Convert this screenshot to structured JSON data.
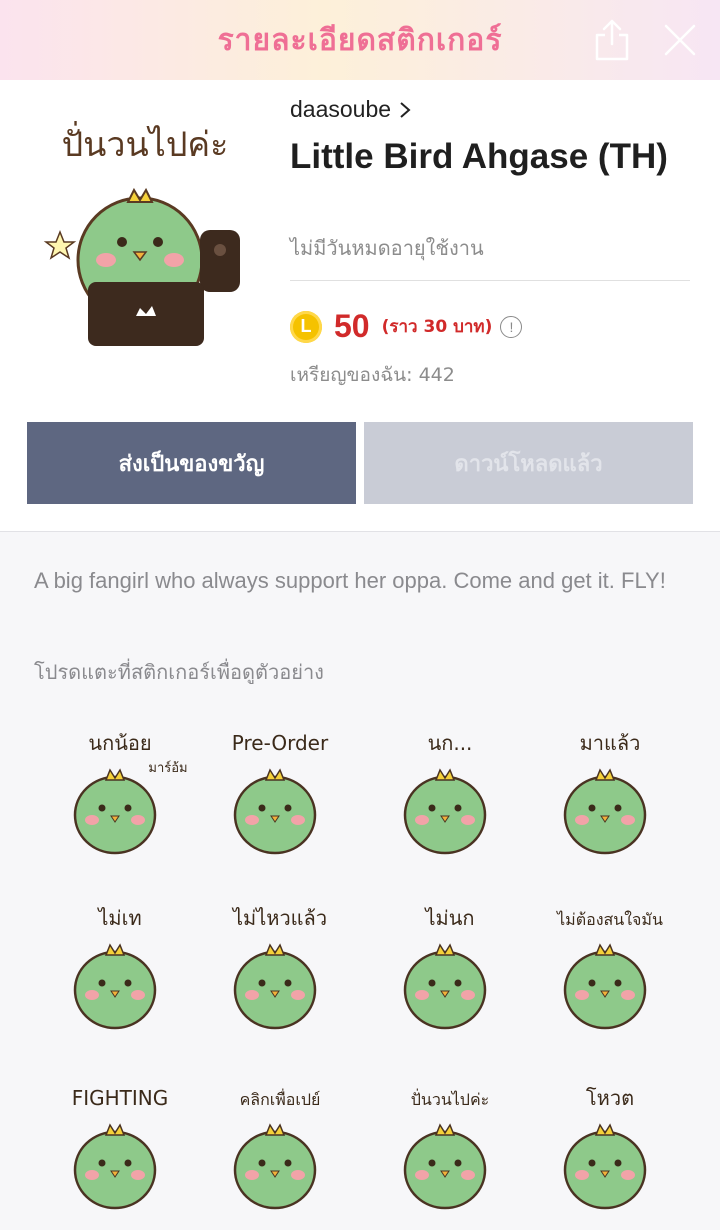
{
  "header": {
    "title": "รายละเอียดสติกเกอร์",
    "share_icon": "share-icon",
    "close_icon": "close-icon"
  },
  "package": {
    "author": "daasoube",
    "title": "Little Bird Ahgase (TH)",
    "validity": "ไม่มีวันหมดอายุใช้งาน",
    "coin_symbol": "L",
    "price": "50",
    "approx_price": "(ราว  30 บาท)",
    "balance": "เหรียญของฉัน: 442",
    "main_sticker_caption": "ปั่นวนไปค่ะ"
  },
  "buttons": {
    "gift": "ส่งเป็นของขวัญ",
    "downloaded": "ดาวน์โหลดแล้ว"
  },
  "description": "A big fangirl who always support her oppa. Come and get it. FLY!",
  "hint": "โปรดแตะที่สติกเกอร์เพื่อดูตัวอย่าง",
  "stickers": [
    {
      "caption": "นกน้อย",
      "extra": "มาร์อ้ม"
    },
    {
      "caption": "Pre-Order"
    },
    {
      "caption": "นก..."
    },
    {
      "caption": "มาแล้ว"
    },
    {
      "caption": "ไม่เท"
    },
    {
      "caption": "ไม่ไหวแล้ว"
    },
    {
      "caption": "ไม่นก"
    },
    {
      "caption": "ไม่ต้องสนใจมัน"
    },
    {
      "caption": "FIGHTING"
    },
    {
      "caption": "คลิกเพื่อเปย์"
    },
    {
      "caption": "ปั่นวนไปค่ะ"
    },
    {
      "caption": "โหวต"
    }
  ],
  "colors": {
    "accent_pink": "#ef6f95",
    "price_red": "#d12a2a",
    "gift_button": "#5e6781",
    "disabled_button": "#c9ccd6",
    "bird_green": "#8ec98a"
  }
}
